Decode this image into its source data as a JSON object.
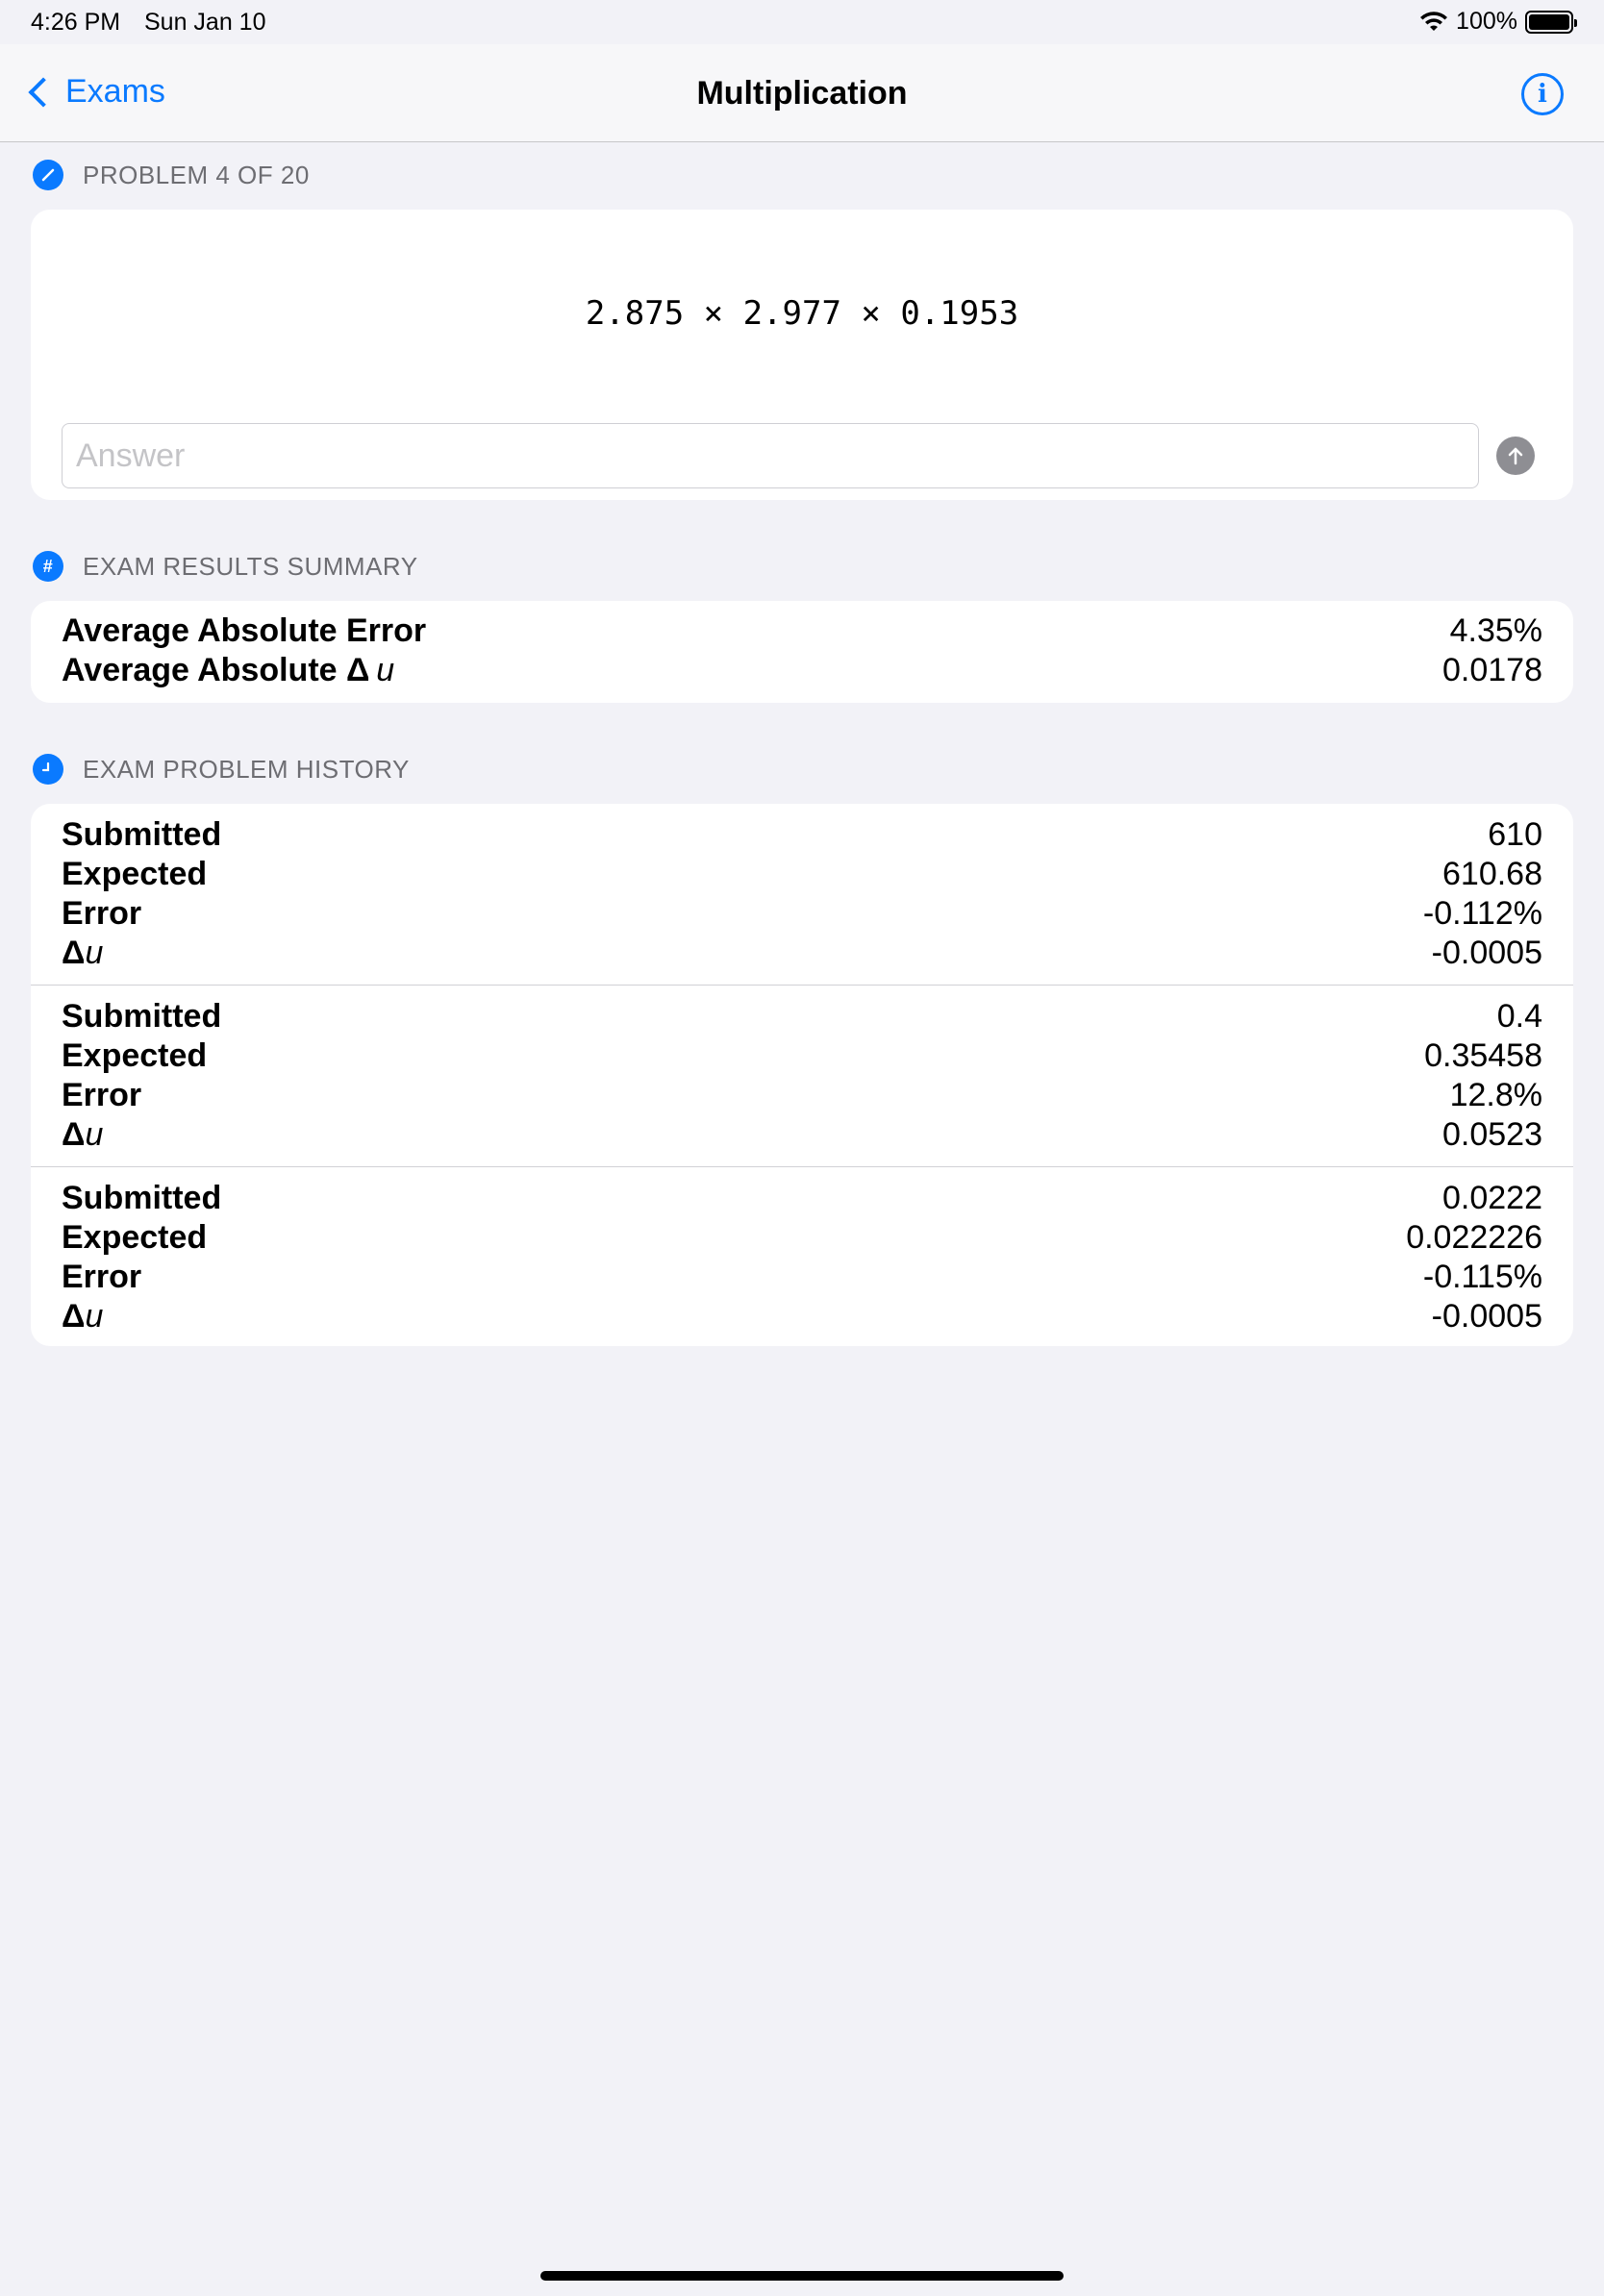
{
  "status_bar": {
    "time": "4:26 PM",
    "date": "Sun Jan 10",
    "battery": "100%"
  },
  "nav": {
    "back_label": "Exams",
    "title": "Multiplication",
    "info_icon": "i"
  },
  "problem": {
    "header": "PROBLEM 4 OF 20",
    "expression": "2.875 × 2.977 × 0.1953",
    "answer_placeholder": "Answer",
    "answer_value": ""
  },
  "summary": {
    "header": "EXAM RESULTS SUMMARY",
    "icon": "#",
    "rows": [
      {
        "label": "Average Absolute Error",
        "value": "4.35%"
      },
      {
        "label": "Average Absolute Δ",
        "label_var": "u",
        "value": "0.0178"
      }
    ]
  },
  "history": {
    "header": "EXAM PROBLEM HISTORY",
    "labels": {
      "submitted": "Submitted",
      "expected": "Expected",
      "error": "Error",
      "delta": "Δ",
      "delta_var": "u"
    },
    "entries": [
      {
        "submitted": "610",
        "expected": "610.68",
        "error": "-0.112%",
        "delta": "-0.0005"
      },
      {
        "submitted": "0.4",
        "expected": "0.35458",
        "error": "12.8%",
        "delta": "0.0523"
      },
      {
        "submitted": "0.0222",
        "expected": "0.022226",
        "error": "-0.115%",
        "delta": "-0.0005"
      }
    ]
  },
  "colors": {
    "accent": "#0a7aff",
    "background": "#f2f2f7",
    "card": "#ffffff",
    "secondary_text": "#6d6d72"
  }
}
